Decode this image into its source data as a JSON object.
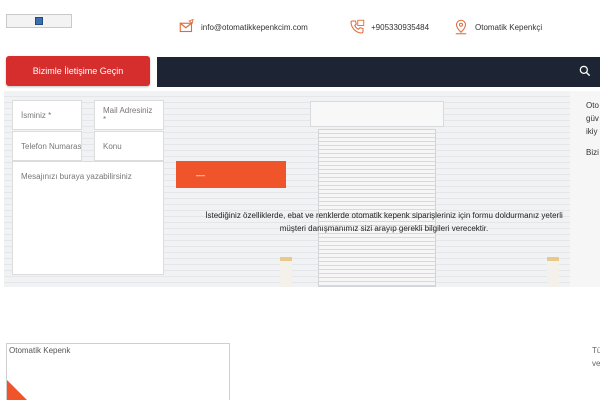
{
  "header": {
    "email": "info@otomatikkepenkcim.com",
    "phone": "+905330935484",
    "location": "Otomatik Kepenkçi"
  },
  "nav": {
    "cta_label": "Bizimle İletişime Geçin"
  },
  "form": {
    "name_placeholder": "İsminiz *",
    "email_placeholder": "Mail Adresiniz *",
    "phone_placeholder": "Telefon Numarası",
    "subject_placeholder": "Konu",
    "message_placeholder": "Mesajınızı buraya yazabilirsiniz",
    "submit_label": "—"
  },
  "info_text": "İstediğiniz özelliklerde, ebat ve renklerde otomatik kepenk siparişleriniz için formu doldurmanız yeterli müşteri danışmanımız sizi arayıp gerekli bilgileri verecektir.",
  "side_text": [
    "Oto",
    "güv",
    "ikiy",
    "Bizi"
  ],
  "lower": {
    "card_title": "Otomatik Kepenk",
    "tail_text": [
      "Tü",
      "ve"
    ]
  },
  "colors": {
    "nav_bg": "#1d2433",
    "cta_red": "#d62d2d",
    "accent_orange": "#f0542a"
  },
  "icons": {
    "email": "envelope-icon",
    "phone": "phone-icon",
    "location": "map-pin-icon",
    "search": "search-icon"
  }
}
